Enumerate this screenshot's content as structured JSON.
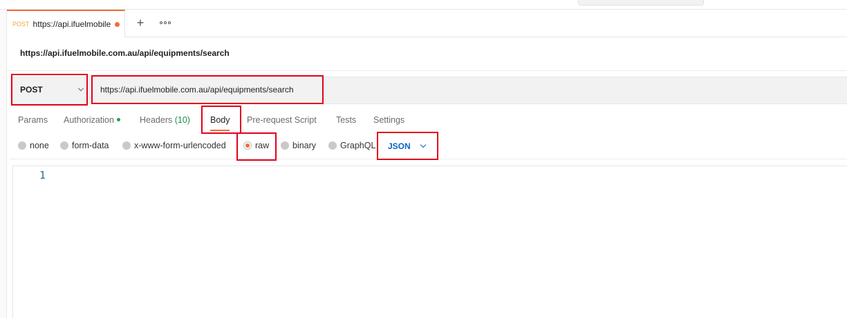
{
  "tab": {
    "method": "POST",
    "title": "https://api.ifuelmobile",
    "unsaved": true
  },
  "request": {
    "name": "https://api.ifuelmobile.com.au/api/equipments/search",
    "method": "POST",
    "url": "https://api.ifuelmobile.com.au/api/equipments/search"
  },
  "request_tabs": {
    "params": "Params",
    "authorization": "Authorization",
    "headers": "Headers",
    "headers_count": "(10)",
    "body": "Body",
    "prerequest": "Pre-request Script",
    "tests": "Tests",
    "settings": "Settings",
    "active": "Body"
  },
  "body_types": {
    "none": "none",
    "form_data": "form-data",
    "urlencoded": "x-www-form-urlencoded",
    "raw": "raw",
    "binary": "binary",
    "graphql": "GraphQL",
    "selected": "raw",
    "format": "JSON"
  },
  "editor": {
    "line_numbers": [
      "1"
    ]
  },
  "colors": {
    "accent": "#f26b3a",
    "highlight_box": "#e2001a",
    "json_blue": "#0b63c5",
    "auth_dot": "#1aa251"
  },
  "icons": {
    "add_tab": "plus-icon",
    "more": "more-options-icon",
    "method_chevron": "chevron-down-icon",
    "format_chevron": "chevron-down-icon"
  }
}
